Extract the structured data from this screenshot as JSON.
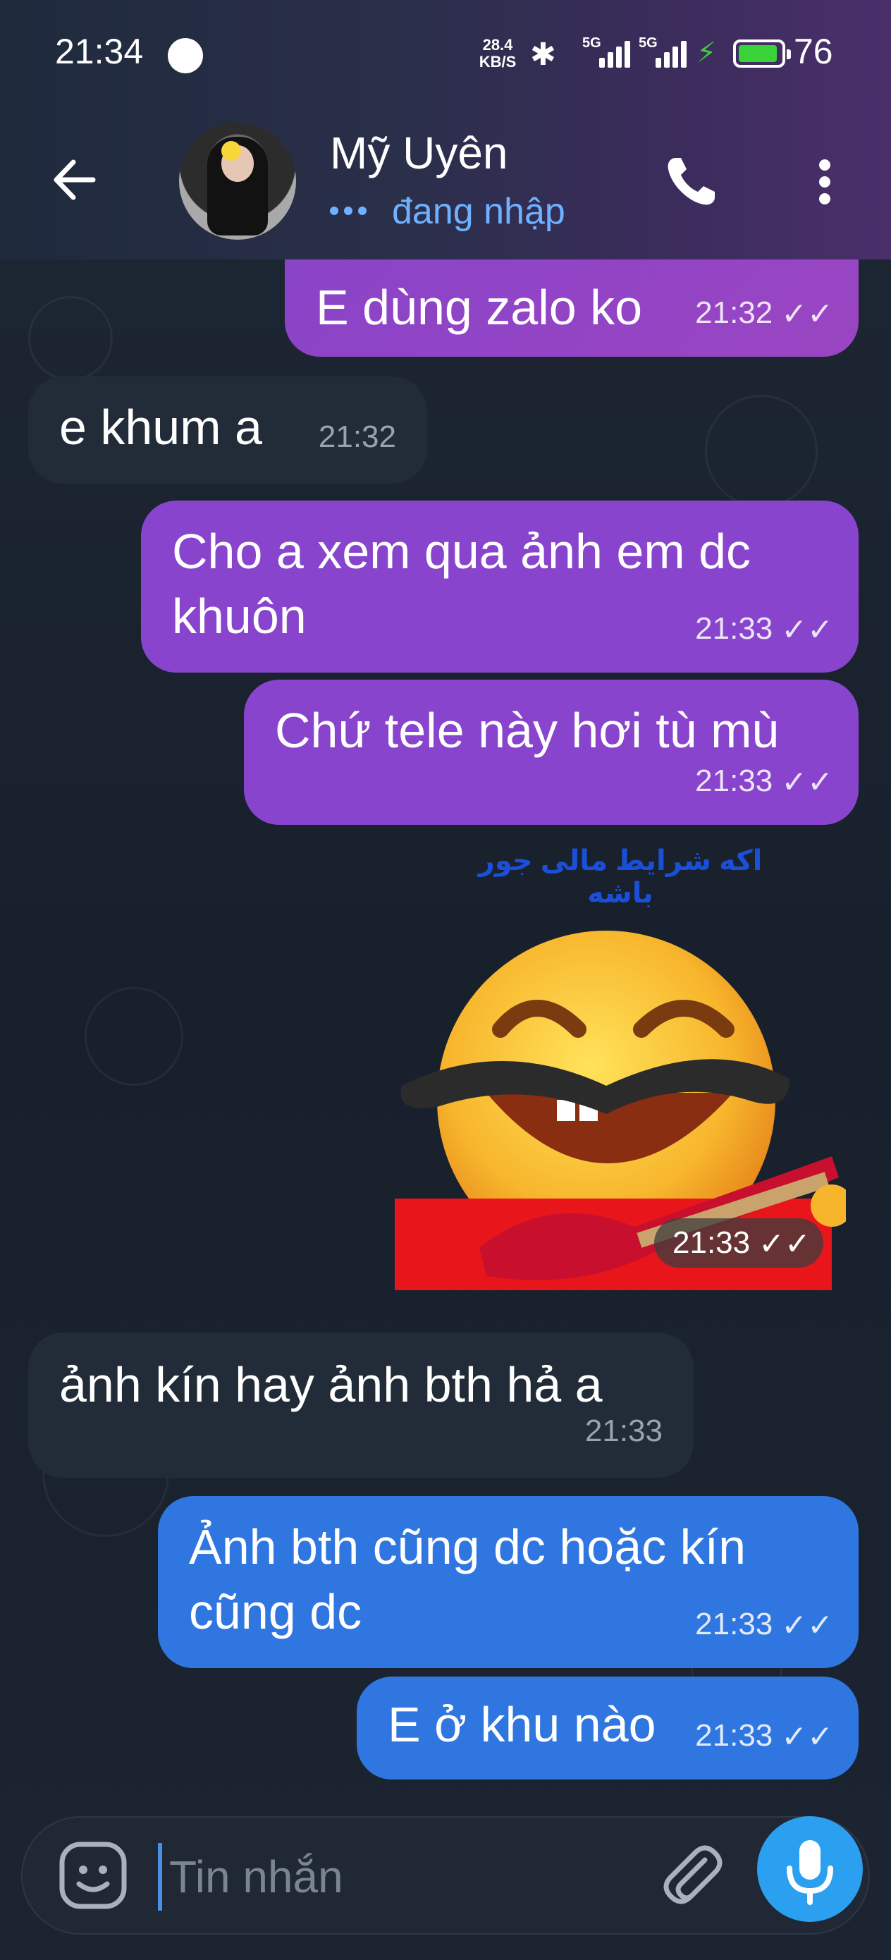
{
  "status_bar": {
    "time": "21:34",
    "net_speed_value": "28.4",
    "net_speed_unit": "KB/S",
    "sim1": "5G",
    "sim2": "5G",
    "battery": "76"
  },
  "header": {
    "contact_name": "Mỹ Uyên",
    "contact_status": "đang nhập",
    "accent": "#6fb1ff"
  },
  "messages": [
    {
      "dir": "out",
      "text": "E dùng zalo ko",
      "time": "21:32",
      "read": true
    },
    {
      "dir": "in",
      "text": "e khum a",
      "time": "21:32"
    },
    {
      "dir": "out",
      "text": "Cho a xem qua ảnh em dc khuôn",
      "time": "21:33",
      "read": true
    },
    {
      "dir": "out",
      "text": "Chứ tele này hơi tù mù",
      "time": "21:33",
      "read": true
    },
    {
      "dir": "out",
      "type": "sticker",
      "caption": "اکه شرایط مالی جور باشه",
      "time": "21:33",
      "read": true
    },
    {
      "dir": "in",
      "text": "ảnh kín hay ảnh bth hả a",
      "time": "21:33"
    },
    {
      "dir": "out",
      "text": "Ảnh bth cũng dc hoặc kín cũng dc",
      "time": "21:33",
      "read": true
    },
    {
      "dir": "out",
      "text": "E ở khu nào",
      "time": "21:33",
      "read": true
    }
  ],
  "input": {
    "placeholder": "Tin nhắn"
  },
  "colors": {
    "bubble_purple": "#8844cc",
    "bubble_blue": "#2f76e0",
    "bubble_incoming": "#222c38",
    "mic_button": "#2b9ff0"
  }
}
